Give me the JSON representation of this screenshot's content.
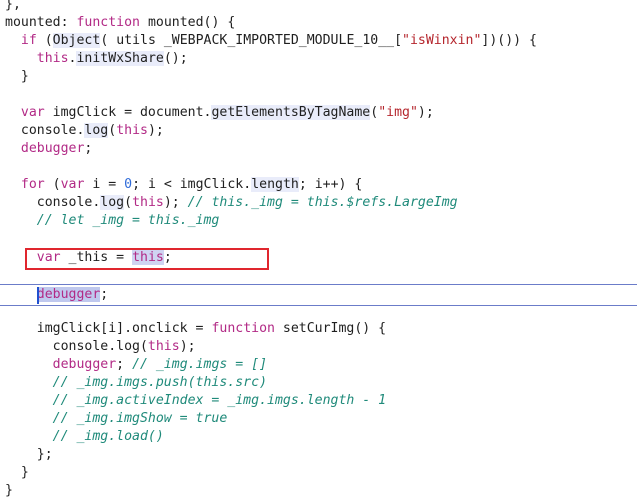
{
  "code": {
    "l01": "},",
    "l02a": "mounted: ",
    "l02b": "function",
    "l02c": " mounted() {",
    "l03a": "  ",
    "l03b": "if",
    "l03c": " (",
    "l03d": "Object",
    "l03e": "( utils _WEBPACK_IMPORTED_MODULE_10__[",
    "l03f": "\"isWinxin\"",
    "l03g": "])()) {",
    "l04a": "    ",
    "l04b": "this",
    "l04c": ".",
    "l04d": "initWxShare",
    "l04e": "();",
    "l05": "  }",
    "l06a": "  ",
    "l06b": "var",
    "l06c": " imgClick = document.",
    "l06d": "getElementsByTagName",
    "l06e": "(",
    "l06f": "\"img\"",
    "l06g": ");",
    "l07a": "  console.",
    "l07b": "log",
    "l07c": "(",
    "l07d": "this",
    "l07e": ");",
    "l08a": "  ",
    "l08b": "debugger",
    "l08c": ";",
    "l09a": "  ",
    "l09b": "for",
    "l09c": " (",
    "l09d": "var",
    "l09e": " i = ",
    "l09f": "0",
    "l09g": "; i < imgClick.",
    "l09h": "length",
    "l09i": "; i++) {",
    "l10a": "    console.",
    "l10b": "log",
    "l10c": "(",
    "l10d": "this",
    "l10e": "); ",
    "l10f": "// this._img = this.$refs.LargeImg",
    "l11": "    // let _img = this._img",
    "l12a": "    ",
    "l12b": "var",
    "l12c": " _this = ",
    "l12d": "this",
    "l12e": ";",
    "l13a": "    ",
    "l13b": "debugger",
    "l13c": ";",
    "l14a": "    imgClick[i].onclick = ",
    "l14b": "function",
    "l14c": " setCurImg() {",
    "l15a": "      console.log(",
    "l15b": "this",
    "l15c": ");",
    "l16a": "      ",
    "l16b": "debugger",
    "l16c": "; ",
    "l16d": "// _img.imgs = []",
    "l17": "      // _img.imgs.push(this.src)",
    "l18": "      // _img.activeIndex = _img.imgs.length - 1",
    "l19": "      // _img.imgShow = true",
    "l20": "      // _img.load()",
    "l21": "    };",
    "l22": "  }",
    "l23": "}"
  },
  "colors": {
    "keyword": "#b22a86",
    "string": "#b5262d",
    "number": "#2f6bd9",
    "comment": "#1f8a7a",
    "highlight_box": "#e0262e",
    "current_line": "#6b7cc9"
  }
}
